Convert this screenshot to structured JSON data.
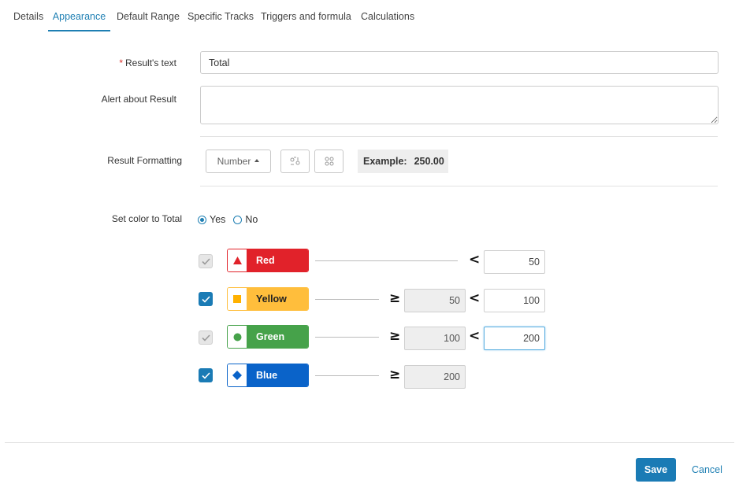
{
  "tabs": [
    {
      "label": "Details"
    },
    {
      "label": "Appearance"
    },
    {
      "label": "Default Range"
    },
    {
      "label": "Specific Tracks"
    },
    {
      "label": "Triggers and formula"
    },
    {
      "label": "Calculations"
    }
  ],
  "form": {
    "results_text": {
      "required_mark": "*",
      "label": "Result's text",
      "value": "Total"
    },
    "alert": {
      "label": "Alert about Result",
      "value": ""
    },
    "formatting": {
      "label": "Result Formatting",
      "format_button": "Number",
      "example_label": "Example:",
      "example_value": "250.00"
    },
    "set_color": {
      "label": "Set color to Total",
      "yes_label": "Yes",
      "no_label": "No",
      "selected": "Yes"
    }
  },
  "color_rules": [
    {
      "name": "Red",
      "color": "#e1222a",
      "checkbox": "disabled",
      "icon": "triangle-icon",
      "ge": "",
      "lt": "50"
    },
    {
      "name": "Yellow",
      "color": "#ffbe3c",
      "checkbox": "checked",
      "icon": "square-icon",
      "ge": "50",
      "lt": "100"
    },
    {
      "name": "Green",
      "color": "#46a24a",
      "checkbox": "disabled",
      "icon": "circle-icon",
      "ge": "100",
      "lt": "200"
    },
    {
      "name": "Blue",
      "color": "#0a63c9",
      "checkbox": "checked",
      "icon": "diamond-icon",
      "ge": "200",
      "lt": ""
    }
  ],
  "operators": {
    "lt": "<",
    "ge": "≥"
  },
  "footer": {
    "save_label": "Save",
    "cancel_label": "Cancel"
  }
}
